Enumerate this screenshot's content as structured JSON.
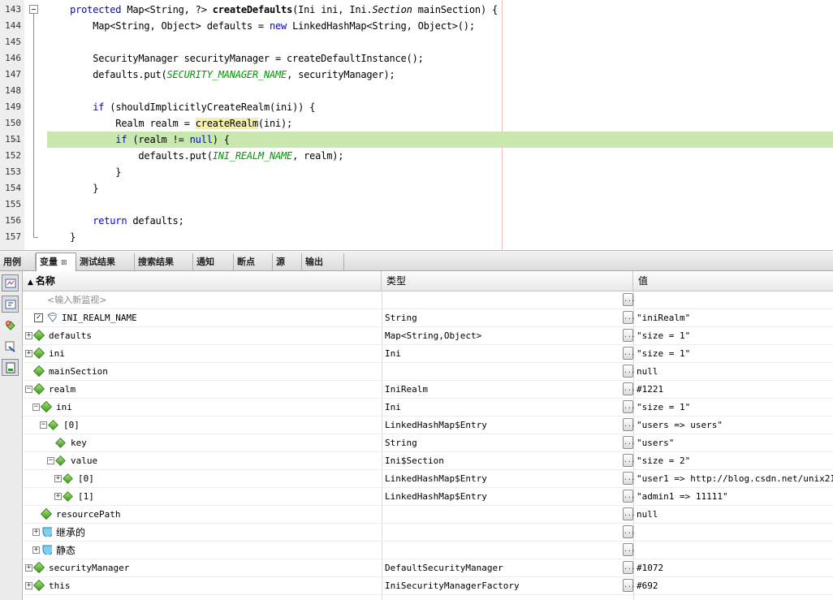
{
  "editor": {
    "lines": [
      {
        "num": "143",
        "code": [
          {
            "t": "    "
          },
          {
            "t": "protected",
            "c": "kw"
          },
          {
            "t": " Map<String, ?> "
          },
          {
            "t": "createDefaults",
            "c": "bold"
          },
          {
            "t": "(Ini ini, Ini."
          },
          {
            "t": "Section",
            "c": "ital"
          },
          {
            "t": " mainSection) {"
          }
        ]
      },
      {
        "num": "144",
        "code": [
          {
            "t": "        Map<String, Object> defaults = "
          },
          {
            "t": "new",
            "c": "kw"
          },
          {
            "t": " LinkedHashMap<String, Object>();"
          }
        ]
      },
      {
        "num": "145",
        "code": [
          {
            "t": ""
          }
        ]
      },
      {
        "num": "146",
        "code": [
          {
            "t": "        SecurityManager securityManager = createDefaultInstance();"
          }
        ]
      },
      {
        "num": "147",
        "code": [
          {
            "t": "        defaults.put("
          },
          {
            "t": "SECURITY_MANAGER_NAME",
            "c": "cst"
          },
          {
            "t": ", securityManager);"
          }
        ]
      },
      {
        "num": "148",
        "code": [
          {
            "t": ""
          }
        ]
      },
      {
        "num": "149",
        "code": [
          {
            "t": "        "
          },
          {
            "t": "if",
            "c": "kw"
          },
          {
            "t": " (shouldImplicitlyCreateRealm(ini)) {"
          }
        ]
      },
      {
        "num": "150",
        "code": [
          {
            "t": "            Realm realm = "
          },
          {
            "t": "createRealm",
            "c": "yel"
          },
          {
            "t": "(ini);"
          }
        ]
      },
      {
        "num": "151",
        "code": [
          {
            "t": "            "
          },
          {
            "t": "if",
            "c": "kw"
          },
          {
            "t": " (realm != "
          },
          {
            "t": "null",
            "c": "kw"
          },
          {
            "t": ") {"
          }
        ]
      },
      {
        "num": "152",
        "code": [
          {
            "t": "                defaults.put("
          },
          {
            "t": "INI_REALM_NAME",
            "c": "cst"
          },
          {
            "t": ", realm);"
          }
        ]
      },
      {
        "num": "153",
        "code": [
          {
            "t": "            }"
          }
        ]
      },
      {
        "num": "154",
        "code": [
          {
            "t": "        }"
          }
        ]
      },
      {
        "num": "155",
        "code": [
          {
            "t": ""
          }
        ]
      },
      {
        "num": "156",
        "code": [
          {
            "t": "        "
          },
          {
            "t": "return",
            "c": "kw"
          },
          {
            "t": " defaults;"
          }
        ]
      },
      {
        "num": "157",
        "code": [
          {
            "t": "    }"
          }
        ]
      }
    ]
  },
  "tabs": [
    {
      "label": "用例"
    },
    {
      "label": "变量",
      "close": "⊠"
    },
    {
      "label": "测试结果"
    },
    {
      "label": "搜索结果"
    },
    {
      "label": "通知"
    },
    {
      "label": "断点"
    },
    {
      "label": "源"
    },
    {
      "label": "输出"
    }
  ],
  "table": {
    "headers": {
      "name": "名称",
      "type": "类型",
      "value": "值",
      "sort_glyph": "▲"
    },
    "watch_placeholder": "<输入新监视>",
    "btn_glyph": "...",
    "rows": [
      {
        "name": "INI_REALM_NAME",
        "type": "String",
        "value": "\"iniRealm\""
      },
      {
        "name": "defaults",
        "type": "Map<String,Object>",
        "value": "\"size = 1\"",
        "exp": "+"
      },
      {
        "name": "ini",
        "type": "Ini",
        "value": "\"size = 1\"",
        "exp": "+"
      },
      {
        "name": "mainSection",
        "type": "",
        "value": "null"
      },
      {
        "name": "realm",
        "type": "IniRealm",
        "value": "#1221",
        "exp": "−"
      },
      {
        "name": "ini",
        "type": "Ini",
        "value": "\"size = 1\"",
        "exp": "−"
      },
      {
        "name": "[0]",
        "type": "LinkedHashMap$Entry",
        "value": "\"users => users\"",
        "exp": "−"
      },
      {
        "name": "key",
        "type": "String",
        "value": "\"users\""
      },
      {
        "name": "value",
        "type": "Ini$Section",
        "value": "\"size = 2\"",
        "exp": "−"
      },
      {
        "name": "[0]",
        "type": "LinkedHashMap$Entry",
        "value": "\"user1 => http://blog.csdn.net/unix21\"",
        "exp": "+"
      },
      {
        "name": "[1]",
        "type": "LinkedHashMap$Entry",
        "value": "\"admin1 => 11111\"",
        "exp": "+"
      },
      {
        "name": "resourcePath",
        "type": "",
        "value": "null"
      },
      {
        "name": "继承的",
        "type": "",
        "value": "",
        "exp": "+"
      },
      {
        "name": "静态",
        "type": "",
        "value": "",
        "exp": "+"
      },
      {
        "name": "securityManager",
        "type": "DefaultSecurityManager",
        "value": "#1072",
        "exp": "+"
      },
      {
        "name": "this",
        "type": "IniSecurityManagerFactory",
        "value": "#692",
        "exp": "+"
      }
    ]
  },
  "gutter": {
    "exec_arrow": "⇨"
  },
  "colors": {
    "exec_line": "#c8e8b0",
    "keyword": "#0000e6",
    "constant": "#009900"
  }
}
